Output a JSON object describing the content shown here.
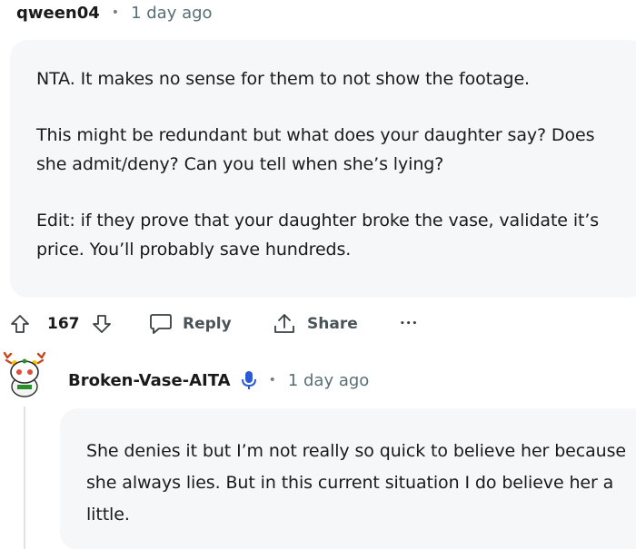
{
  "comment": {
    "username": "qween04",
    "separator": "•",
    "timestamp": "1 day ago",
    "paragraphs": [
      "NTA. It makes no sense for them to not show the footage.",
      "This might be redundant but what does your daughter say? Does she admit/deny? Can you tell when she’s lying?",
      "Edit: if they prove that your daughter broke the vase, validate it’s price. You’ll probably save hundreds."
    ],
    "actions": {
      "vote_count": "167",
      "reply_label": "Reply",
      "share_label": "Share",
      "more_label": "•••"
    }
  },
  "reply": {
    "username": "Broken-Vase-AITA",
    "separator": "•",
    "timestamp": "1 day ago",
    "paragraphs": [
      "She denies it but I’m not really so quick to believe her because she always lies. But in this current situation I do believe her a little."
    ]
  },
  "colors": {
    "bubble_bg": "#f6f7f8",
    "muted_text": "#576f76",
    "action_text": "#4a5358",
    "op_badge": "#2a5bd7"
  },
  "icons": [
    "upvote-icon",
    "downvote-icon",
    "reply-icon",
    "share-icon",
    "more-options-icon",
    "avatar-icon",
    "microphone-badge-icon"
  ]
}
